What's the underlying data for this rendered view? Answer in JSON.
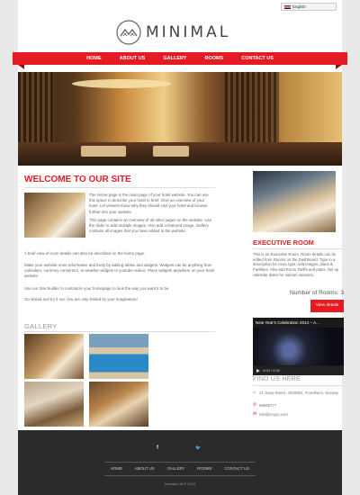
{
  "header": {
    "language": "English",
    "logo_text": "MINIMAL"
  },
  "nav": {
    "items": [
      "HOME",
      "ABOUT US",
      "GALLERY",
      "ROOMS",
      "CONTACT US"
    ]
  },
  "main": {
    "title": "WELCOME TO OUR SITE",
    "intro_p1": "The Home page is the main page of your hotel website. You can use this space to describe your hotel in brief. Give an overview of your hotel. Let viewers know why they should visit your hotel and browse further into your website.",
    "intro_p2": "This page contains an overview of all other pages on the website. Use the slider to add multiple images. Also add a featured image. Gallery contains all images that you have added to the website.",
    "p3": "A brief view of room details can also be described on the home page.",
    "p4": "Make your website more informative and lively by adding tables and widgets. Widgets can be anything from calendars, currency convertors, to weather widgets to youtube videos. Place widgets anywhere on your hotel website.",
    "p5": "Use our Site Builder to customize your homepage to look the way you want it to be.",
    "p6": "Go ahead and try it out. You are only limited by your imagination!",
    "gallery_title": "GALLERY"
  },
  "sidebar": {
    "room_title": "EXECUTIVE ROOM",
    "room_text": "This is an Executive Room. Room details can be edited from Rooms on the Dashboard. Type in a description for room type. Add images, plans & Facilities. Also add Room Tariffs and plans. Set up calendar dates for various seasons.",
    "rooms_count": "Number of Rooms: 3",
    "view_details": "View details",
    "video_title": "New Year's Celebration 2014 – A...",
    "video_time": "0:00 / 0:00",
    "find_title": "FIND US HERE",
    "address": "21 Jump Street, 4200001, Trondheim, Norway",
    "phone": "99888777",
    "email": "info@imyyo.com"
  },
  "footer": {
    "facebook": "f",
    "twitter": "🐦",
    "nav": [
      "HOME",
      "ABOUT US",
      "GALLERY",
      "ROOMS",
      "CONTACT US"
    ],
    "copyright": "Imenan Ltd © 2014"
  }
}
